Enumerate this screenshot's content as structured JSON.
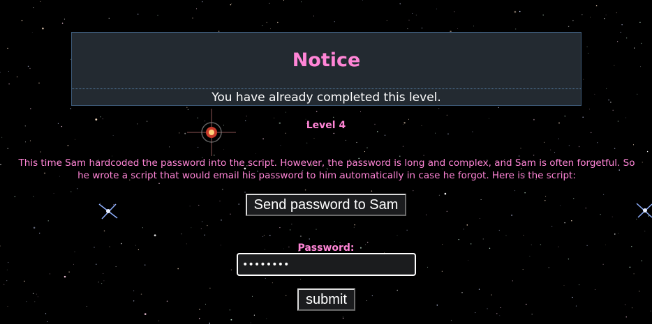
{
  "notice": {
    "title": "Notice",
    "message": "You have already completed this level."
  },
  "level": {
    "heading": "Level 4",
    "description": "This time Sam hardcoded the password into the script. However, the password is long and complex, and Sam is often forgetful. So he wrote a script that would email his password to him automatically in case he forgot. Here is the script:"
  },
  "send_button": {
    "label": "Send password to Sam"
  },
  "password": {
    "label": "Password:",
    "value": "••••••••"
  },
  "submit_button": {
    "label": "submit"
  },
  "colors": {
    "accent_pink": "#ff85d6",
    "notice_bg": "#232a31",
    "background": "#000000"
  }
}
